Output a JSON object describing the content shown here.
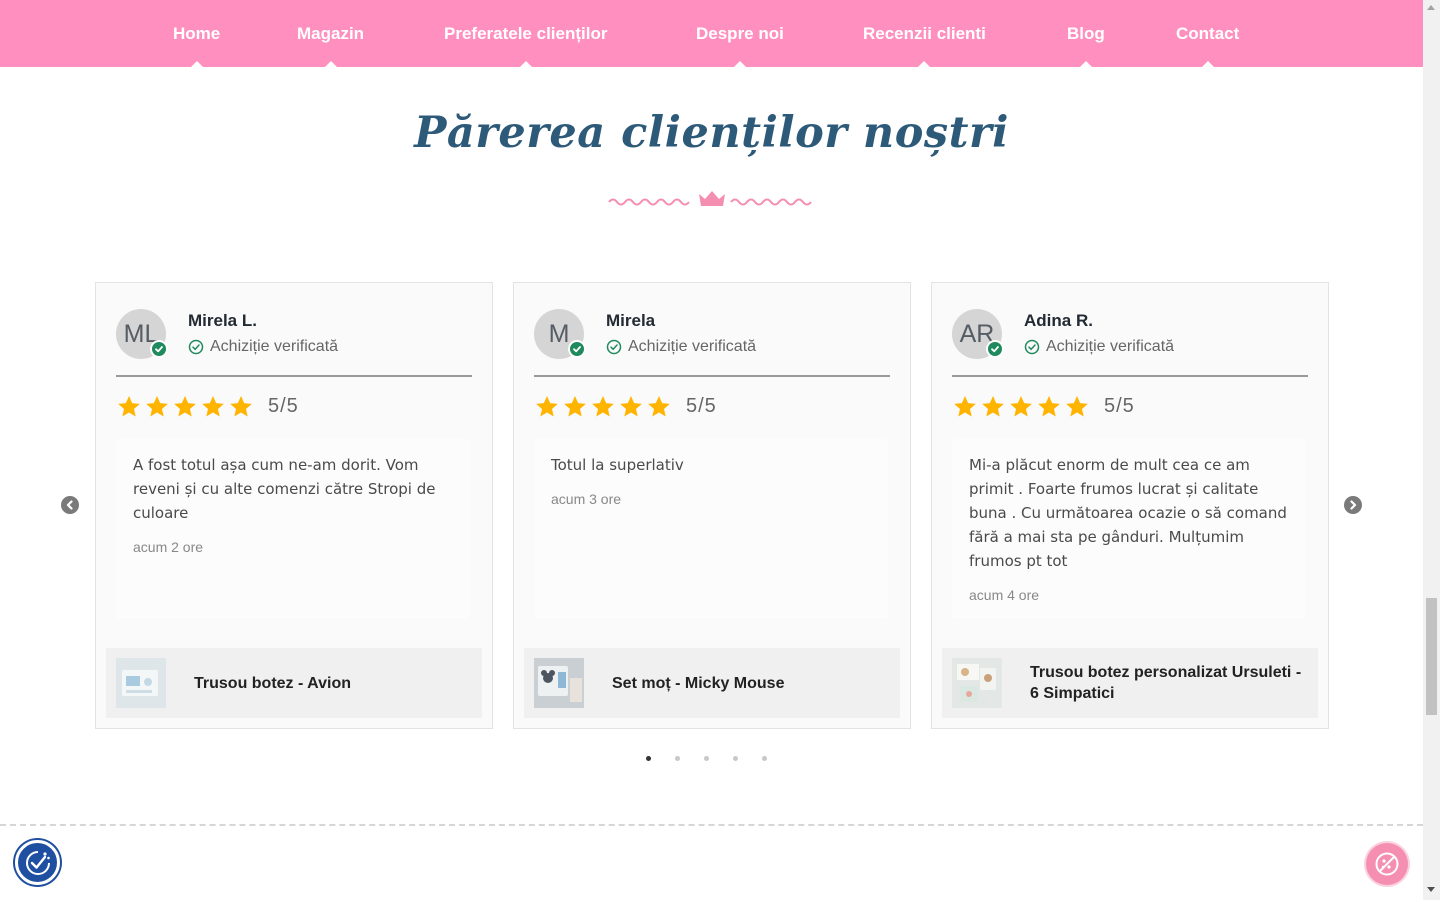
{
  "nav": {
    "items": [
      {
        "label": "Home"
      },
      {
        "label": "Magazin"
      },
      {
        "label": "Preferatele clienților"
      },
      {
        "label": "Despre noi"
      },
      {
        "label": "Recenzii clienti"
      },
      {
        "label": "Blog"
      },
      {
        "label": "Contact"
      }
    ]
  },
  "section": {
    "title": "Părerea clienților noștri"
  },
  "reviews": [
    {
      "initials": "ML",
      "name": "Mirela L.",
      "verified": "Achiziție verificată",
      "rating": 5,
      "score": "5/5",
      "text": "A fost totul așa cum ne-am dorit. Vom reveni și cu alte comenzi către Stropi de culoare",
      "time": "acum 2 ore",
      "product": "Trusou botez - Avion"
    },
    {
      "initials": "M",
      "name": "Mirela",
      "verified": "Achiziție verificată",
      "rating": 5,
      "score": "5/5",
      "text": "Totul la superlativ",
      "time": "acum 3 ore",
      "product": "Set moț - Micky Mouse"
    },
    {
      "initials": "AR",
      "name": "Adina R.",
      "verified": "Achiziție verificată",
      "rating": 5,
      "score": "5/5",
      "text": "Mi-a plăcut enorm de mult cea ce am primit . Foarte frumos lucrat și calitate buna . Cu următoarea ocazie o să comand fără a mai sta pe gânduri. Mulțumim frumos pt tot",
      "time": "acum 4 ore",
      "product": "Trusou botez personalizat Ursuleti - 6 Simpatici"
    }
  ],
  "carousel": {
    "page_count": 5,
    "active_page": 1
  },
  "colors": {
    "nav_bg": "#ff8fbf",
    "title": "#2e5a79",
    "star": "#ffb400",
    "verified_green": "#1f8a5e",
    "accessibility_blue": "#1f4fa0",
    "cookie_pink": "#f48fb1"
  },
  "icons": {
    "prev": "chevron-left-circle-icon",
    "next": "chevron-right-circle-icon",
    "verified": "check-circle-icon",
    "accessibility": "accessibility-icon",
    "cookie": "cookie-icon"
  }
}
